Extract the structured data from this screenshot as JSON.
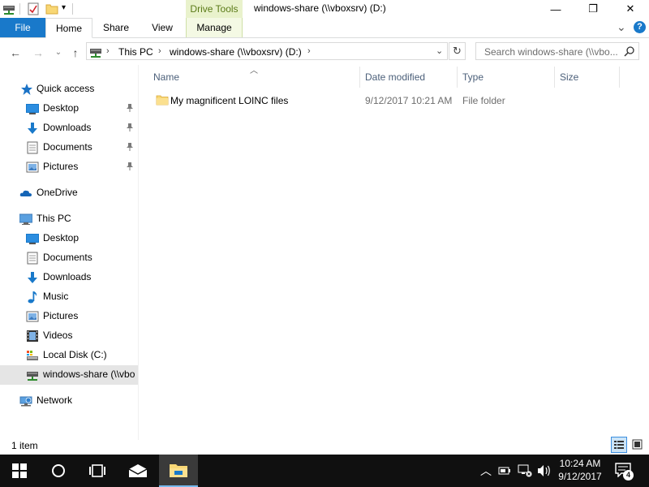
{
  "window": {
    "title": "windows-share (\\\\vboxsrv) (D:)",
    "minimize": "—",
    "maximize": "❐",
    "close": "✕"
  },
  "ribbon": {
    "file": "File",
    "home": "Home",
    "share": "Share",
    "view": "View",
    "context_group": "Drive Tools",
    "manage": "Manage",
    "collapse": "⌄",
    "help": "?"
  },
  "address": {
    "crumbs": [
      "This PC",
      "windows-share (\\\\vboxsrv) (D:)"
    ],
    "search_placeholder": "Search windows-share (\\\\vbo..."
  },
  "nav": {
    "quick_access": "Quick access",
    "qa_items": [
      "Desktop",
      "Downloads",
      "Documents",
      "Pictures"
    ],
    "onedrive": "OneDrive",
    "this_pc": "This PC",
    "pc_items": [
      "Desktop",
      "Documents",
      "Downloads",
      "Music",
      "Pictures",
      "Videos",
      "Local Disk (C:)",
      "windows-share (\\\\vbo"
    ],
    "network": "Network"
  },
  "columns": {
    "name": "Name",
    "date": "Date modified",
    "type": "Type",
    "size": "Size"
  },
  "files": [
    {
      "name": "My magnificent LOINC files",
      "date": "9/12/2017 10:21 AM",
      "type": "File folder",
      "size": ""
    }
  ],
  "status": {
    "count": "1 item"
  },
  "taskbar": {
    "time": "10:24 AM",
    "date": "9/12/2017",
    "notifications": "4"
  },
  "colors": {
    "accent": "#1979ca",
    "context_tab": "#e9f2cc",
    "selected_nav": "#e5e5e5",
    "taskbar": "#101010"
  }
}
